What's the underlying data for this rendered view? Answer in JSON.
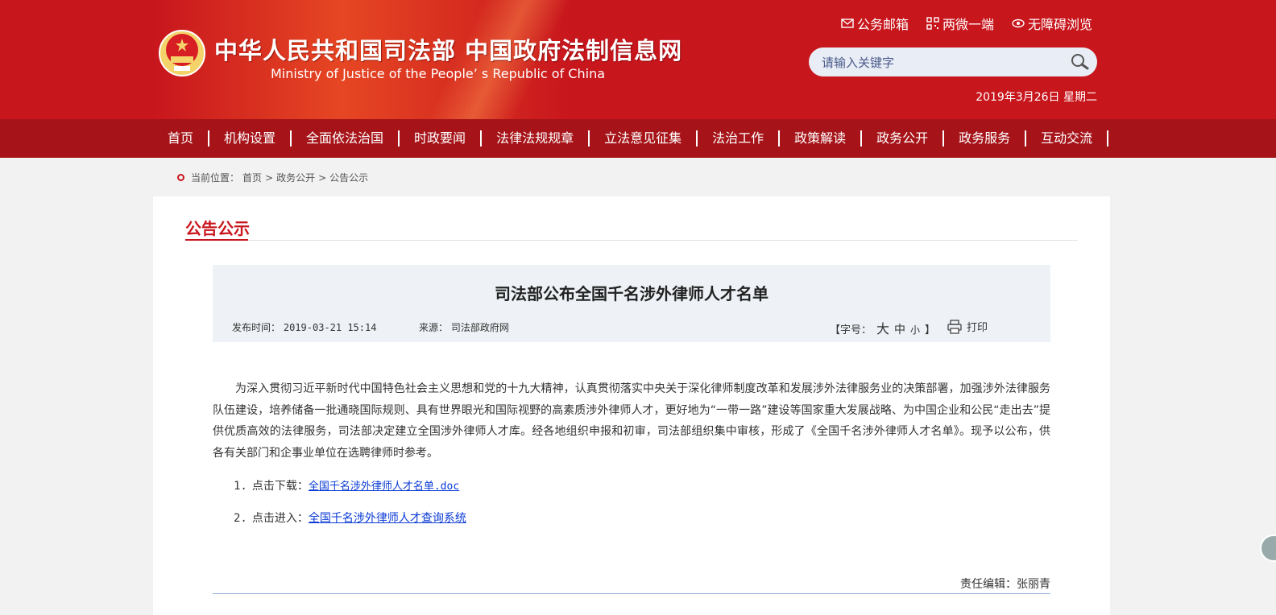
{
  "header": {
    "site_title": "中华人民共和国司法部  中国政府法制信息网",
    "site_subtitle": "Ministry of Justice of the People’ s Republic of China",
    "top_links": [
      {
        "label": "公务邮箱",
        "icon": "mail-icon"
      },
      {
        "label": "两微一端",
        "icon": "qr-code-icon"
      },
      {
        "label": "无障碍浏览",
        "icon": "eye-icon"
      }
    ],
    "search": {
      "placeholder": "请输入关键字"
    },
    "date": "2019年3月26日 星期二"
  },
  "nav": {
    "items": [
      "首页",
      "机构设置",
      "全面依法治国",
      "时政要闻",
      "法律法规规章",
      "立法意见征集",
      "法治工作",
      "政策解读",
      "政务公开",
      "政务服务",
      "互动交流"
    ]
  },
  "breadcrumb": {
    "prefix": "当前位置：",
    "items": [
      "首页",
      "政务公开",
      "公告公示"
    ],
    "separator": ">"
  },
  "section": {
    "title": "公告公示"
  },
  "article": {
    "title": "司法部公布全国千名涉外律师人才名单",
    "publish_label": "发布时间：",
    "publish_time": "2019-03-21 15:14",
    "source_label": "来源：",
    "source": "司法部政府网",
    "fontsize_open": "【字号：",
    "fontsize_big": "大",
    "fontsize_mid": "中",
    "fontsize_small": "小",
    "fontsize_close": "】",
    "print_label": "打印",
    "body": "为深入贯彻习近平新时代中国特色社会主义思想和党的十九大精神，认真贯彻落实中央关于深化律师制度改革和发展涉外法律服务业的决策部署，加强涉外法律服务队伍建设，培养储备一批通晓国际规则、具有世界眼光和国际视野的高素质涉外律师人才，更好地为“一带一路”建设等国家重大发展战略、为中国企业和公民“走出去”提供优质高效的法律服务，司法部决定建立全国涉外律师人才库。经各地组织申报和初审，司法部组织集中审核，形成了《全国千名涉外律师人才名单》。现予以公布，供各有关部门和企事业单位在选聘律师时参考。",
    "links": [
      {
        "num": "1.",
        "prefix": "点击下载：",
        "text": "全国千名涉外律师人才名单.doc"
      },
      {
        "num": "2.",
        "prefix": "点击进入：",
        "text": "全国千名涉外律师人才查询系统"
      }
    ],
    "editor": "责任编辑：张丽青"
  },
  "colors": {
    "brand_red": "#c8161d",
    "nav_red": "#a61419",
    "link_blue": "#0b3bd6"
  }
}
